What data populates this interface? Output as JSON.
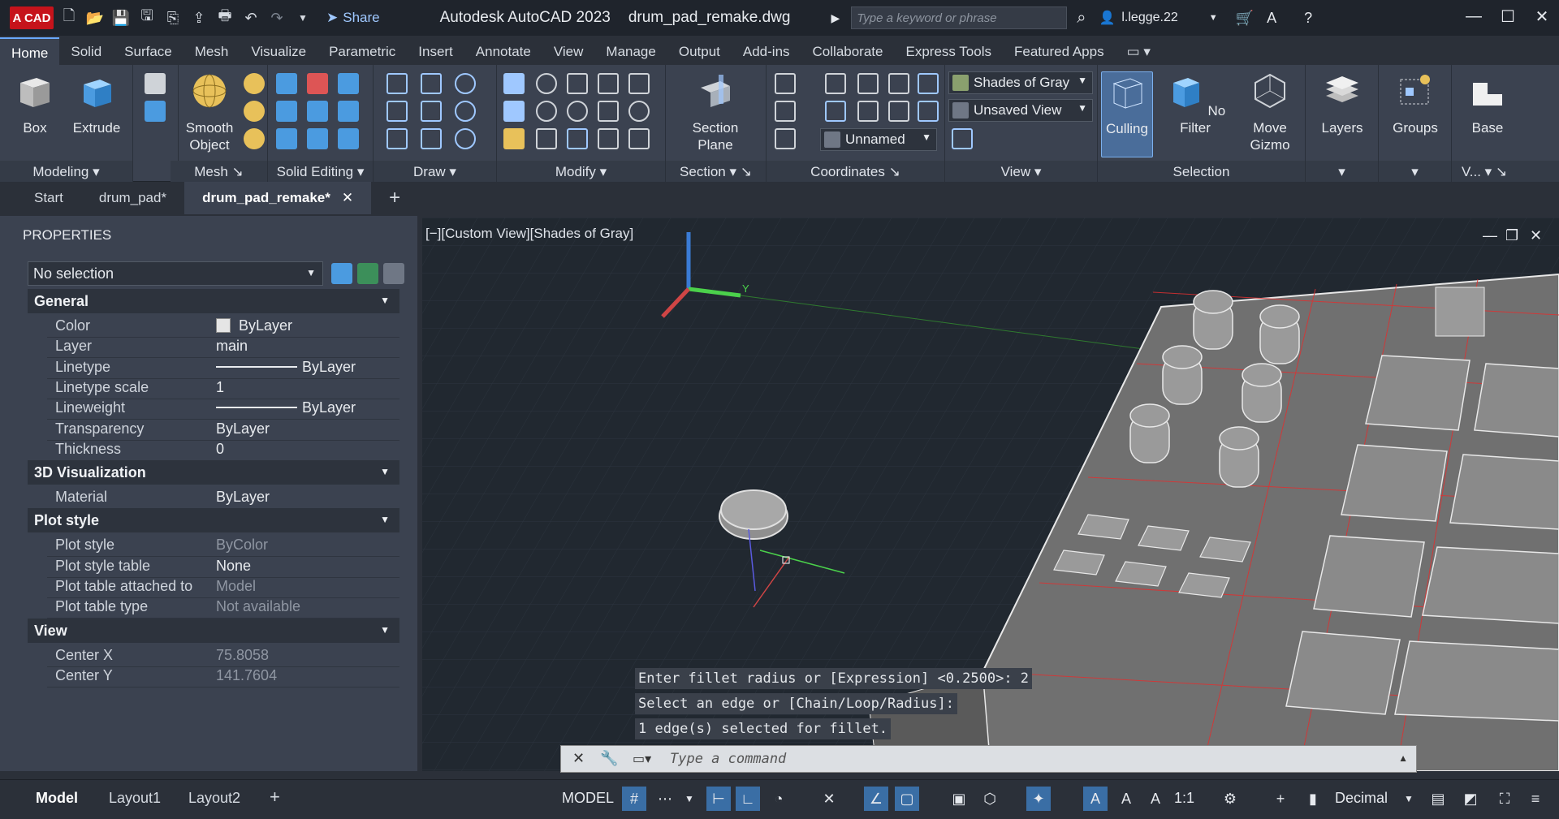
{
  "titlebar": {
    "logo": "A CAD",
    "share": "Share",
    "app_title": "Autodesk AutoCAD 2023",
    "file": "drum_pad_remake.dwg",
    "search_placeholder": "Type a keyword or phrase",
    "user": "l.legge.22"
  },
  "ribbon_tabs": [
    "Home",
    "Solid",
    "Surface",
    "Mesh",
    "Visualize",
    "Parametric",
    "Insert",
    "Annotate",
    "View",
    "Manage",
    "Output",
    "Add-ins",
    "Collaborate",
    "Express Tools",
    "Featured Apps"
  ],
  "ribbon": {
    "box": "Box",
    "extrude": "Extrude",
    "smooth1": "Smooth",
    "smooth2": "Object",
    "section1": "Section",
    "section2": "Plane",
    "visual_style": "Shades of Gray",
    "view_name": "Unsaved View",
    "ucs_name": "Unnamed",
    "culling": "Culling",
    "nofilter": "No Filter",
    "move1": "Move",
    "move2": "Gizmo",
    "layers": "Layers",
    "groups": "Groups",
    "base": "Base",
    "panels": {
      "modeling": "Modeling",
      "mesh": "Mesh",
      "solid_editing": "Solid Editing",
      "draw": "Draw",
      "modify": "Modify",
      "section": "Section",
      "coordinates": "Coordinates",
      "view": "View",
      "selection": "Selection",
      "v": "V..."
    }
  },
  "doc_tabs": [
    "Start",
    "drum_pad*",
    "drum_pad_remake*"
  ],
  "properties": {
    "title": "PROPERTIES",
    "selection": "No selection",
    "general": {
      "header": "General",
      "rows": [
        {
          "k": "Color",
          "v": "ByLayer"
        },
        {
          "k": "Layer",
          "v": "main"
        },
        {
          "k": "Linetype",
          "v": "ByLayer"
        },
        {
          "k": "Linetype scale",
          "v": "1"
        },
        {
          "k": "Lineweight",
          "v": "ByLayer"
        },
        {
          "k": "Transparency",
          "v": "ByLayer"
        },
        {
          "k": "Thickness",
          "v": "0"
        }
      ]
    },
    "viz": {
      "header": "3D Visualization",
      "rows": [
        {
          "k": "Material",
          "v": "ByLayer"
        }
      ]
    },
    "plot": {
      "header": "Plot style",
      "rows": [
        {
          "k": "Plot style",
          "v": "ByColor"
        },
        {
          "k": "Plot style table",
          "v": "None"
        },
        {
          "k": "Plot table attached to",
          "v": "Model"
        },
        {
          "k": "Plot table type",
          "v": "Not available"
        }
      ]
    },
    "view": {
      "header": "View",
      "rows": [
        {
          "k": "Center X",
          "v": "75.8058"
        },
        {
          "k": "Center Y",
          "v": "141.7604"
        }
      ]
    }
  },
  "viewport": {
    "label": "[−][Custom View][Shades of Gray]",
    "axis_y": "Y"
  },
  "command": {
    "history": [
      "Enter fillet radius or [Expression] <0.2500>: 2",
      "Select an edge or [Chain/Loop/Radius]:",
      "1 edge(s) selected for fillet."
    ],
    "placeholder": "Type a command"
  },
  "status": {
    "layout_tabs": [
      "Model",
      "Layout1",
      "Layout2"
    ],
    "model": "MODEL",
    "scale": "1:1",
    "units": "Decimal"
  }
}
